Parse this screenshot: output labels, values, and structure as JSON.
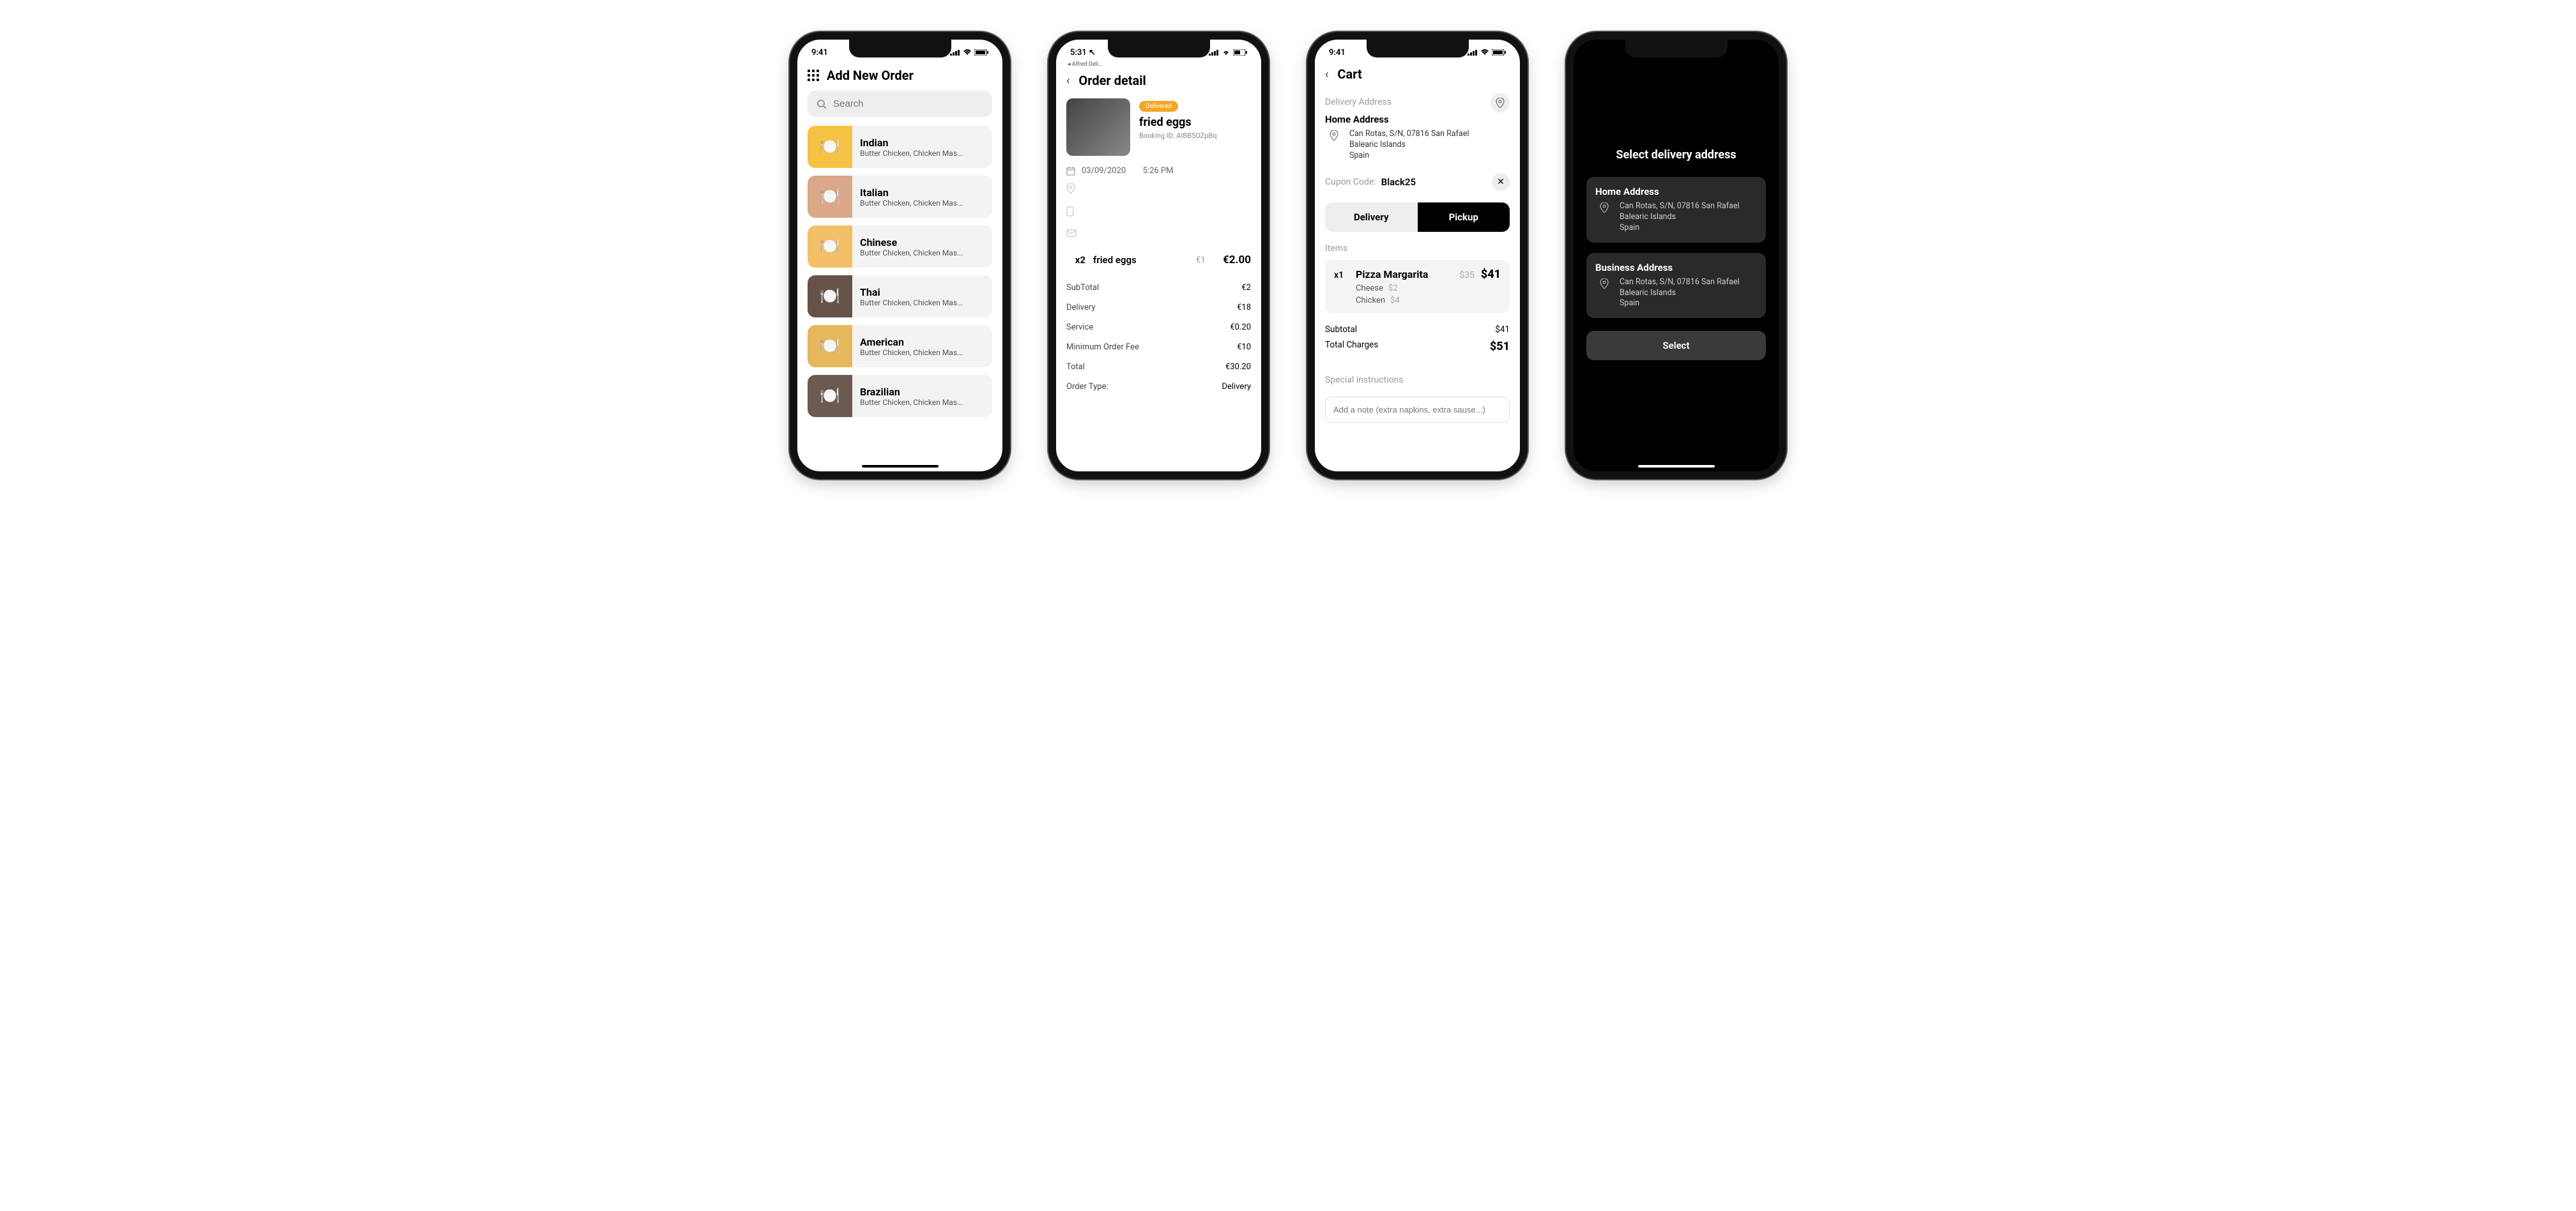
{
  "status": {
    "time1": "9:41",
    "time2": "5:31",
    "time3": "9:41",
    "breadcrumb2": "◂ Alfred Deli..."
  },
  "screen1": {
    "title": "Add New Order",
    "search_placeholder": "Search",
    "categories": [
      {
        "name": "Indian",
        "sub": "Butter Chicken, Chicken Mas...",
        "bg": "#f6c244"
      },
      {
        "name": "Italian",
        "sub": "Butter Chicken, Chicken Mas...",
        "bg": "#d9a98a"
      },
      {
        "name": "Chinese",
        "sub": "Butter Chicken, Chicken Mas...",
        "bg": "#f3c068"
      },
      {
        "name": "Thai",
        "sub": "Butter Chicken, Chicken Mas...",
        "bg": "#655348"
      },
      {
        "name": "American",
        "sub": "Butter Chicken, Chicken Mas...",
        "bg": "#e6b85c"
      },
      {
        "name": "Brazilian",
        "sub": "Butter Chicken, Chicken Mas...",
        "bg": "#6a5a50"
      }
    ]
  },
  "screen2": {
    "title": "Order detail",
    "badge": "Delivered",
    "item_name": "fried eggs",
    "booking_label": "Booking ID:",
    "booking_id": "AIBB5OZpBq",
    "date": "03/09/2020",
    "time": "5:26 PM",
    "line": {
      "qty": "x2",
      "name": "fried eggs",
      "unit": "€1",
      "total": "€2.00"
    },
    "summary": [
      {
        "label": "SubTotal",
        "value": "€2"
      },
      {
        "label": "Delivery",
        "value": "€18"
      },
      {
        "label": "Service",
        "value": "€0.20"
      },
      {
        "label": "Minimum Order Fee",
        "value": "€10"
      },
      {
        "label": "Total",
        "value": "€30.20"
      },
      {
        "label": "Order Type:",
        "value": "Delivery"
      }
    ]
  },
  "screen3": {
    "title": "Cart",
    "section_delivery": "Delivery Address",
    "address_title": "Home Address",
    "address_line1": "Can Rotas, S/N, 07816 San Rafael",
    "address_line2": "Balearic Islands",
    "address_line3": "Spain",
    "coupon_label": "Cupon Code:",
    "coupon_value": "Black25",
    "toggle_delivery": "Delivery",
    "toggle_pickup": "Pickup",
    "items_label": "Items",
    "item": {
      "qty": "x1",
      "name": "Pizza Margarita",
      "base": "$35",
      "total": "$41",
      "addons": [
        {
          "name": "Cheese",
          "price": "$2"
        },
        {
          "name": "Chicken",
          "price": "$4"
        }
      ]
    },
    "subtotal_label": "Subtotal",
    "subtotal_value": "$41",
    "total_label": "Total Charges",
    "total_value": "$51",
    "special_label": "Special instructions",
    "note_placeholder": "Add a note (extra napkins, extra sause...)"
  },
  "screen4": {
    "title": "Select delivery address",
    "addresses": [
      {
        "title": "Home Address",
        "line1": "Can Rotas, S/N, 07816 San Rafael",
        "line2": "Balearic Islands",
        "line3": "Spain"
      },
      {
        "title": "Business Address",
        "line1": "Can Rotas, S/N, 07816 San Rafael",
        "line2": "Balearic Islands",
        "line3": "Spain"
      }
    ],
    "select_label": "Select"
  }
}
